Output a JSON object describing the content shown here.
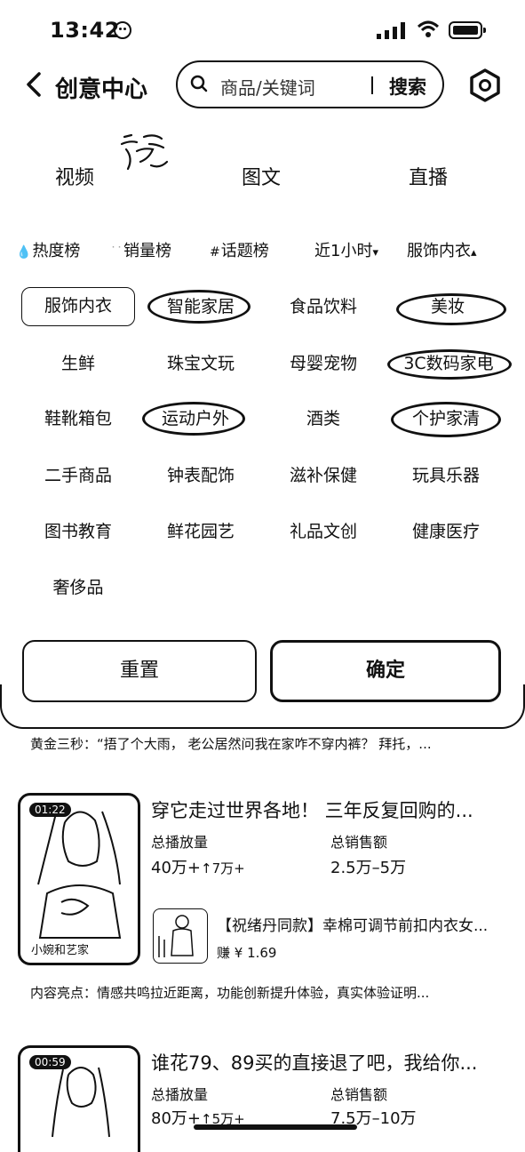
{
  "status": {
    "time": "13:42"
  },
  "header": {
    "title": "创意中心",
    "search_placeholder": "商品/关键词",
    "search_button": "搜索"
  },
  "tabs": [
    "视频",
    "图文",
    "直播"
  ],
  "filters": [
    {
      "icon": "flame-icon",
      "label": "热度榜"
    },
    {
      "icon": "sales-icon",
      "label": "销量榜"
    },
    {
      "icon": "topic-icon",
      "label": "话题榜"
    },
    {
      "label": "近1小时",
      "caret": "▾"
    },
    {
      "label": "服饰内衣",
      "caret": "▴"
    }
  ],
  "categories": [
    "服饰内衣",
    "智能家居",
    "食品饮料",
    "美妆",
    "生鲜",
    "珠宝文玩",
    "母婴宠物",
    "3C数码家电",
    "鞋靴箱包",
    "运动户外",
    "酒类",
    "个护家清",
    "二手商品",
    "钟表配饰",
    "滋补保健",
    "玩具乐器",
    "图书教育",
    "鲜花园艺",
    "礼品文创",
    "健康医疗",
    "奢侈品"
  ],
  "selected_category": "服饰内衣",
  "buttons": {
    "reset": "重置",
    "confirm": "确定"
  },
  "feed": {
    "snippet": "黄金三秒：“捂了个大雨， 老公居然问我在家咋不穿内裤？ 拜托，...",
    "items": [
      {
        "duration": "01:22",
        "thumb_caption": "小婉和艺家",
        "title": "穿它走过世界各地！ 三年反复回购的...",
        "play_label": "总播放量",
        "play_value": "40万+",
        "play_delta": "↑7万+",
        "sales_label": "总销售额",
        "sales_value": "2.5万–5万",
        "product_title": "【祝绪丹同款】幸棉可调节前扣内衣女...",
        "earn": "赚 ¥ 1.69",
        "highlight": "内容亮点：情感共鸣拉近距离，功能创新提升体验，真实体验证明..."
      },
      {
        "duration": "00:59",
        "title": "谁花79、89买的直接退了吧，我给你...",
        "play_label": "总播放量",
        "play_value": "80万+",
        "play_delta": "↑5万+",
        "sales_label": "总销售额",
        "sales_value": "7.5万–10万"
      }
    ]
  }
}
